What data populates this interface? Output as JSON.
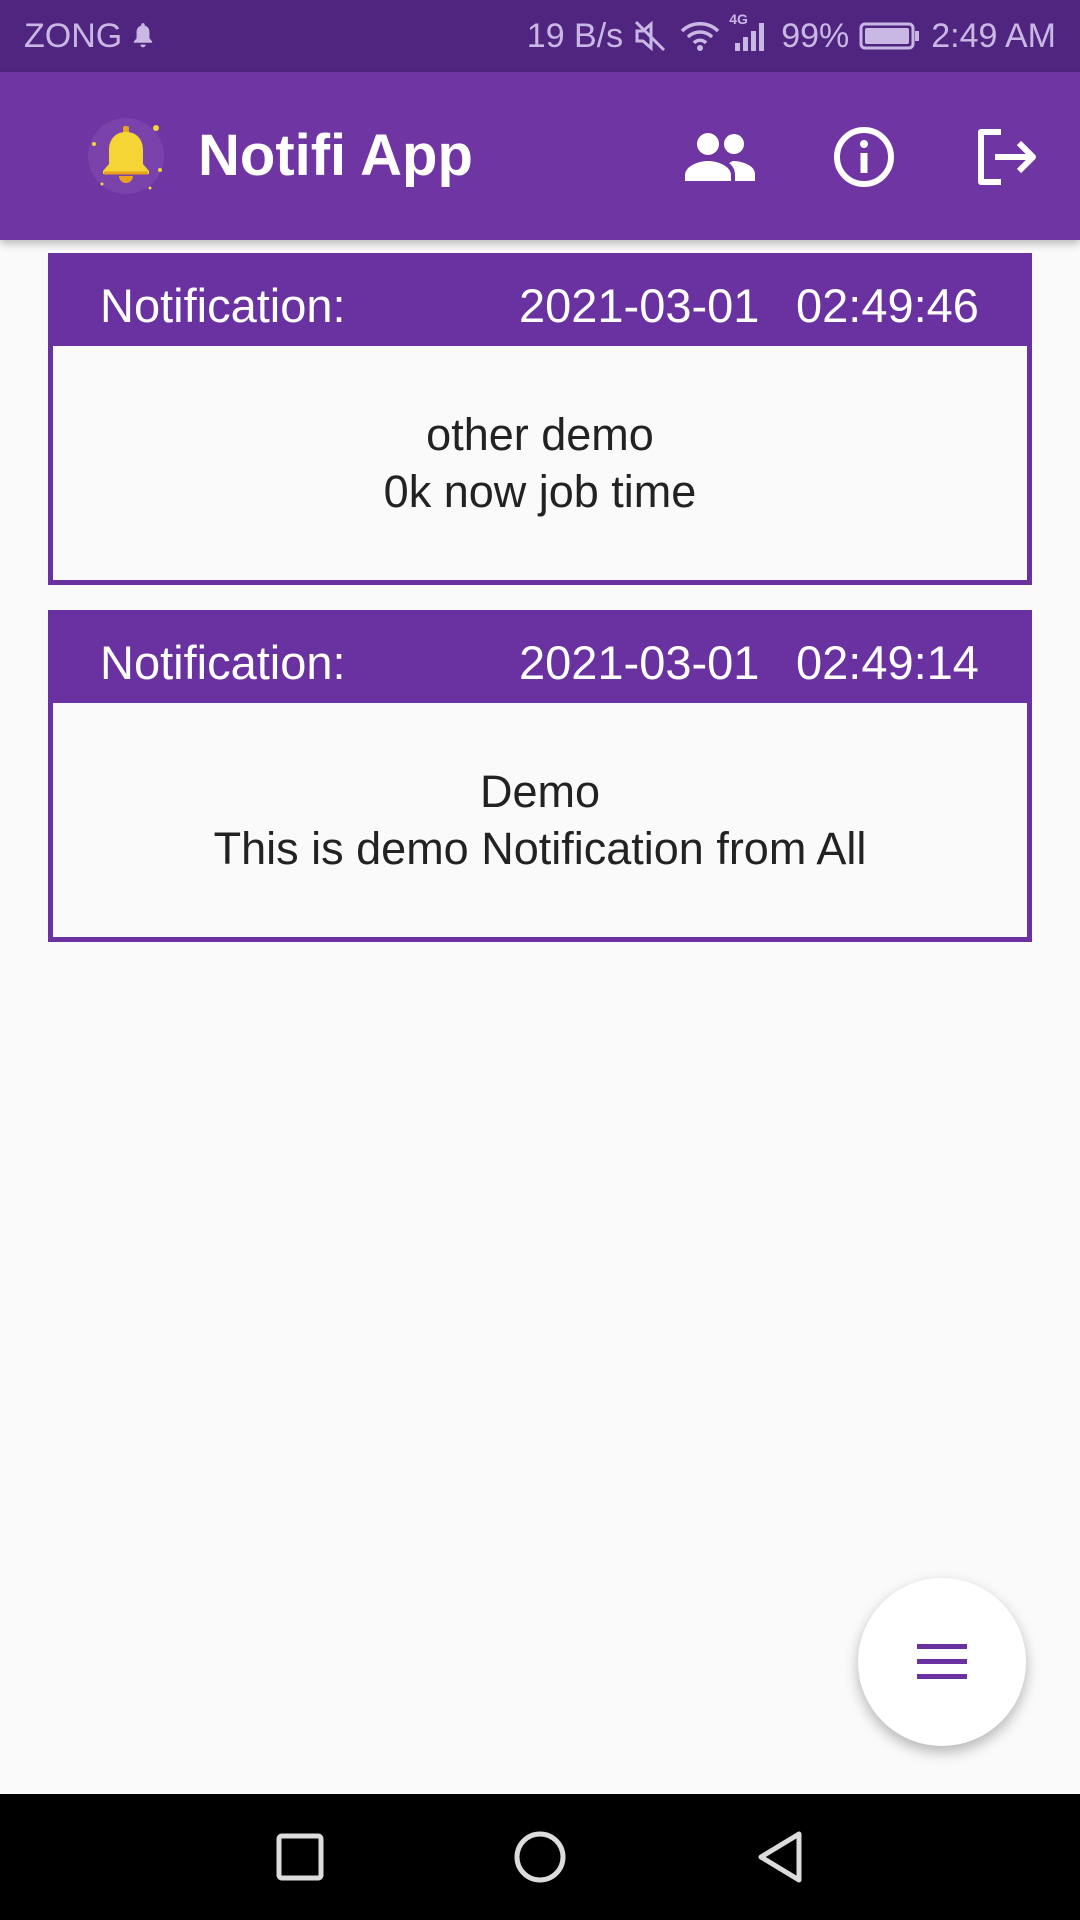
{
  "status_bar": {
    "carrier": "ZONG",
    "data_rate": "19 B/s",
    "network_type": "4G",
    "battery": "99%",
    "time": "2:49 AM"
  },
  "app_bar": {
    "title": "Notifi App",
    "logo_icon": "bell-logo-icon",
    "actions": [
      {
        "name": "users",
        "icon": "people-icon"
      },
      {
        "name": "info",
        "icon": "info-icon"
      },
      {
        "name": "logout",
        "icon": "exit-icon"
      }
    ]
  },
  "notifications": [
    {
      "label": "Notification:",
      "date": "2021-03-01",
      "time": "02:49:46",
      "title": "other demo",
      "message": "0k now job time"
    },
    {
      "label": "Notification:",
      "date": "2021-03-01",
      "time": "02:49:14",
      "title": "Demo",
      "message": "This is demo Notification from All"
    }
  ],
  "fab": {
    "icon": "menu-icon"
  },
  "navigation": {
    "recents_icon": "square-icon",
    "home_icon": "circle-icon",
    "back_icon": "triangle-back-icon"
  },
  "colors": {
    "primary": "#6f35a3",
    "primary_dark": "#4f2580",
    "card_header": "#6a32a0",
    "background": "#fafafa",
    "bell_yellow": "#f5d535"
  }
}
